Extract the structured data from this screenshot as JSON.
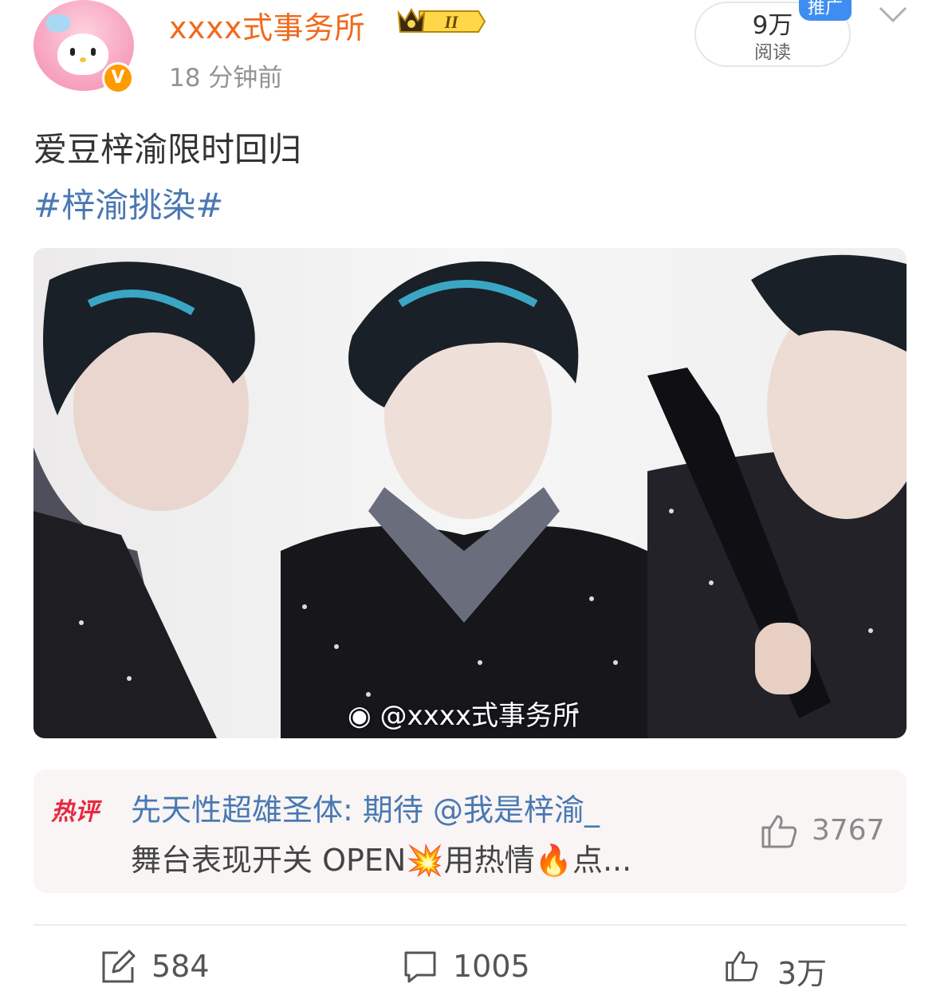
{
  "header": {
    "username": "xxxx式事务所",
    "level_badge": "II",
    "time": "18 分钟前",
    "verified_mark": "V",
    "read_count": "9万",
    "read_label": "阅读",
    "promo_tag": "推广"
  },
  "post": {
    "text": "爱豆梓渝限时回归",
    "hashtag": "#梓渝挑染#",
    "watermark": "@xxxx式事务所"
  },
  "hot_comment": {
    "tag": "热评",
    "user_line": "先天性超雄圣体: 期待 @我是梓渝_",
    "text_line": "舞台表现开关 OPEN💥用热情🔥点...",
    "like_count": "3767"
  },
  "actions": {
    "repost_count": "584",
    "comment_count": "1005",
    "like_count": "3万"
  },
  "icons": [
    "avatar",
    "verified-badge-icon",
    "crown-level-icon",
    "chevron-down-icon",
    "weibo-logo-icon",
    "thumb-up-icon",
    "repost-icon",
    "comment-icon"
  ],
  "colors": {
    "username": "#f06a1d",
    "link": "#4a78b3",
    "hot_tag": "#e8283f",
    "promo": "#3d8ef0",
    "verified": "#ff9a00"
  }
}
